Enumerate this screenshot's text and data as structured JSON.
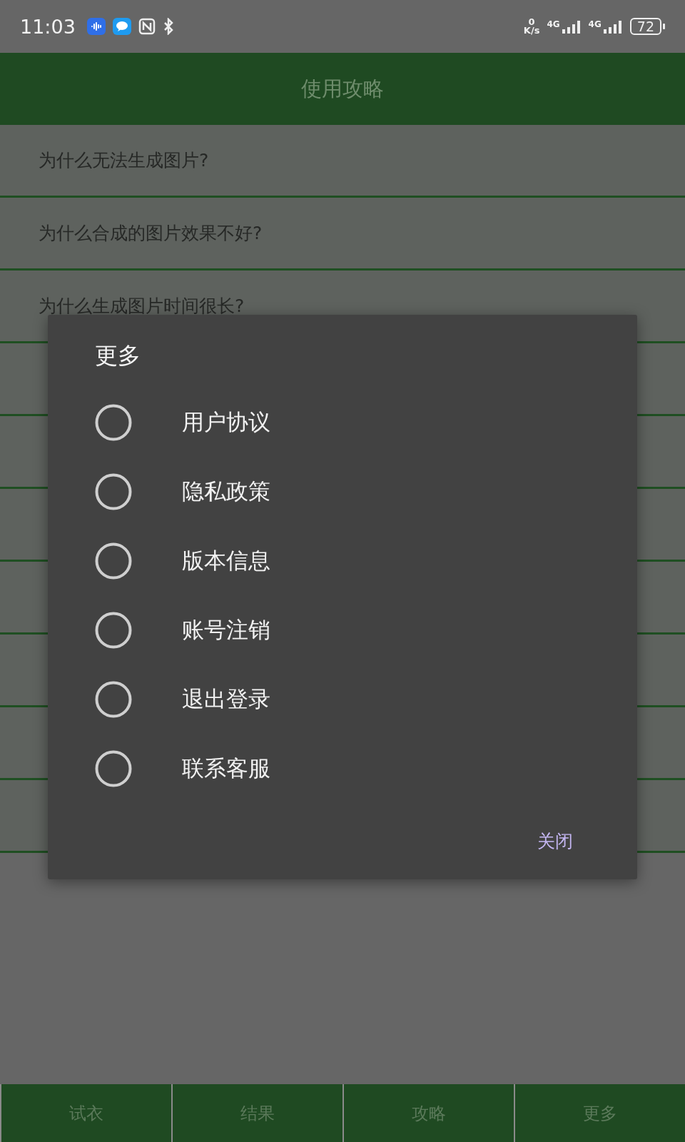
{
  "status_bar": {
    "time": "11:03",
    "speed_value": "0",
    "speed_unit": "K/s",
    "sim_1": "4G",
    "sim_2": "4G",
    "battery": "72"
  },
  "header": {
    "title": "使用攻略"
  },
  "faq": [
    {
      "kind": "text",
      "label": "为什么无法生成图片?"
    },
    {
      "kind": "text",
      "label": "为什么合成的图片效果不好?"
    },
    {
      "kind": "text",
      "label": "为什么生成图片时间很长?"
    },
    {
      "kind": "covered"
    },
    {
      "kind": "covered"
    },
    {
      "kind": "covered"
    },
    {
      "kind": "covered"
    },
    {
      "kind": "covered"
    },
    {
      "kind": "covered"
    },
    {
      "kind": "covered"
    }
  ],
  "dialog": {
    "title": "更多",
    "options": [
      {
        "label": "用户协议",
        "selected": false
      },
      {
        "label": "隐私政策",
        "selected": false
      },
      {
        "label": "版本信息",
        "selected": false
      },
      {
        "label": "账号注销",
        "selected": false
      },
      {
        "label": "退出登录",
        "selected": false
      },
      {
        "label": "联系客服",
        "selected": false
      }
    ],
    "close_button": "关闭"
  },
  "tabs": [
    {
      "label": "试衣"
    },
    {
      "label": "结果"
    },
    {
      "label": "攻略"
    },
    {
      "label": "更多"
    }
  ]
}
